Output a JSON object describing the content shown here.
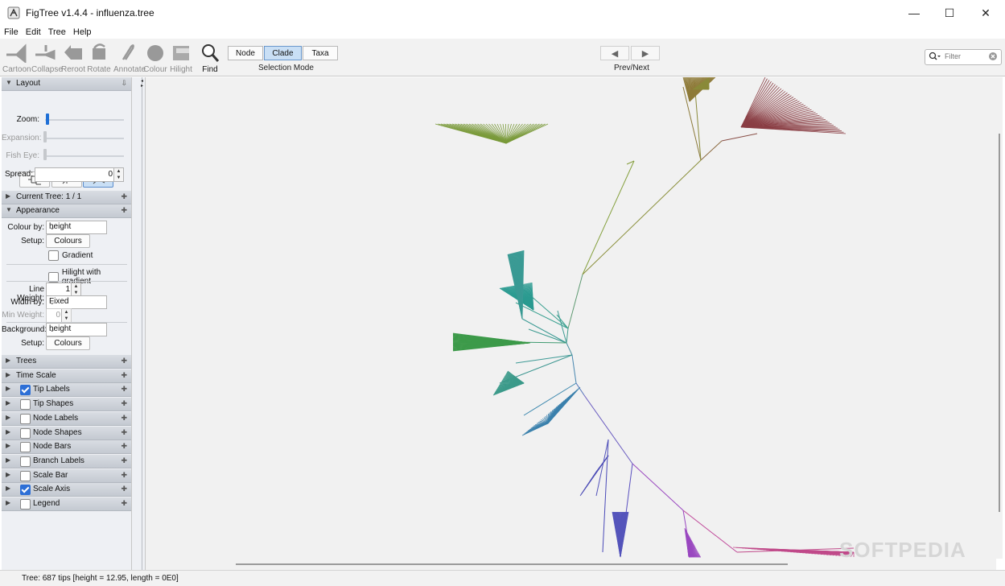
{
  "window": {
    "title": "FigTree v1.4.4 - influenza.tree"
  },
  "menu": [
    "File",
    "Edit",
    "Tree",
    "Help"
  ],
  "toolbar": {
    "tools": [
      {
        "label": "Cartoon",
        "icon": "cartoon-icon"
      },
      {
        "label": "Collapse",
        "icon": "collapse-icon"
      },
      {
        "label": "Reroot",
        "icon": "reroot-icon"
      },
      {
        "label": "Rotate",
        "icon": "rotate-icon"
      },
      {
        "label": "Annotate",
        "icon": "annotate-icon"
      },
      {
        "label": "Colour",
        "icon": "colour-icon"
      },
      {
        "label": "Hilight",
        "icon": "hilight-icon"
      },
      {
        "label": "Find",
        "icon": "find-icon"
      }
    ],
    "selection_mode": {
      "options": [
        "Node",
        "Clade",
        "Taxa"
      ],
      "selected": "Clade",
      "caption": "Selection Mode"
    },
    "prev_next_caption": "Prev/Next",
    "filter_placeholder": "Filter"
  },
  "sidebar": {
    "layout": {
      "title": "Layout",
      "zoom_label": "Zoom:",
      "expansion_label": "Expansion:",
      "fisheye_label": "Fish Eye:",
      "spread_label": "Spread:",
      "spread_value": "0",
      "zoom_level": 0.0
    },
    "current_tree": "Current Tree: 1 / 1",
    "appearance": {
      "title": "Appearance",
      "colour_by_label": "Colour by:",
      "colour_by_value": "height",
      "setup_label": "Setup:",
      "colours_button": "Colours",
      "gradient_label": "Gradient",
      "hilight_gradient_label": "Hilight with gradient",
      "line_weight_label": "Line Weight:",
      "line_weight_value": "1",
      "width_by_label": "Width by:",
      "width_by_value": "Fixed",
      "min_weight_label": "Min Weight:",
      "min_weight_value": "0",
      "background_label": "Background:",
      "background_value": "height",
      "setup2_label": "Setup:",
      "colours2_button": "Colours"
    },
    "sections": [
      {
        "label": "Trees",
        "checkbox": null
      },
      {
        "label": "Time Scale",
        "checkbox": null
      },
      {
        "label": "Tip Labels",
        "checkbox": true
      },
      {
        "label": "Tip Shapes",
        "checkbox": false
      },
      {
        "label": "Node Labels",
        "checkbox": false
      },
      {
        "label": "Node Shapes",
        "checkbox": false
      },
      {
        "label": "Node Bars",
        "checkbox": false
      },
      {
        "label": "Branch Labels",
        "checkbox": false
      },
      {
        "label": "Scale Bar",
        "checkbox": false
      },
      {
        "label": "Scale Axis",
        "checkbox": true
      },
      {
        "label": "Legend",
        "checkbox": false
      }
    ]
  },
  "canvas": {
    "watermark": "SOFTPEDIA"
  },
  "status": "Tree: 687 tips [height = 12.95, length = 0E0]"
}
